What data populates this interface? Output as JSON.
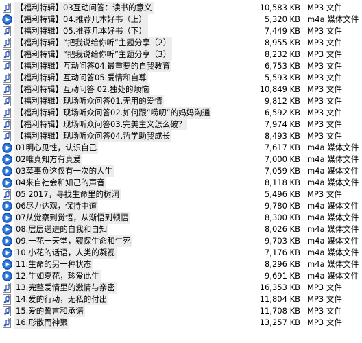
{
  "files": [
    {
      "name": "【福利特辑】03互动问答：读书的意义",
      "size": "10,583 KB",
      "type": "MP3 文件",
      "icon": "mp3-file-icon"
    },
    {
      "name": "【福利特辑】04.推荐几本好书（上）",
      "size": "5,320 KB",
      "type": "m4a 媒体文件",
      "icon": "m4a-media-icon"
    },
    {
      "name": "【福利特辑】05.推荐几本好书（下）",
      "size": "7,449 KB",
      "type": "MP3 文件",
      "icon": "mp3-file-icon"
    },
    {
      "name": "【福利特辑】“把我说给你听”主题分享（2）",
      "size": "8,955 KB",
      "type": "MP3 文件",
      "icon": "mp3-file-icon"
    },
    {
      "name": "【福利特辑】“把我说给你听”主题分享（3）",
      "size": "8,232 KB",
      "type": "MP3 文件",
      "icon": "mp3-file-icon"
    },
    {
      "name": "【福利特辑】互动问答04.最重要的自我教育",
      "size": "6,753 KB",
      "type": "MP3 文件",
      "icon": "mp3-file-icon"
    },
    {
      "name": "【福利特辑】互动问答05.爱情和自尊",
      "size": "5,593 KB",
      "type": "MP3 文件",
      "icon": "mp3-file-icon"
    },
    {
      "name": "【福利特辑】互动问答 02.独处的烦恼",
      "size": "10,849 KB",
      "type": "MP3 文件",
      "icon": "mp3-file-icon"
    },
    {
      "name": "【福利特辑】现场听众问答01.无用的爱情",
      "size": "9,812 KB",
      "type": "MP3 文件",
      "icon": "mp3-file-icon"
    },
    {
      "name": "【福利特辑】现场听众问答02.如何跟“唠叨”的妈妈沟通",
      "size": "6,592 KB",
      "type": "MP3 文件",
      "icon": "mp3-file-icon"
    },
    {
      "name": "【福利特辑】现场听众问答03.完美主义怎么破？",
      "size": "7,974 KB",
      "type": "MP3 文件",
      "icon": "mp3-file-icon"
    },
    {
      "name": "【福利特辑】现场听众问答04.哲学助我成长",
      "size": "8,493 KB",
      "type": "MP3 文件",
      "icon": "mp3-file-icon"
    },
    {
      "name": "01明心见性，认识自己",
      "size": "7,617 KB",
      "type": "m4a 媒体文件",
      "icon": "m4a-media-icon"
    },
    {
      "name": "02唯真知方有真爱",
      "size": "7,000 KB",
      "type": "m4a 媒体文件",
      "icon": "m4a-media-icon"
    },
    {
      "name": "03莫辜负这仅有一次的人生",
      "size": "7,059 KB",
      "type": "m4a 媒体文件",
      "icon": "m4a-media-icon"
    },
    {
      "name": "04来自社会和知己的声音",
      "size": "8,118 KB",
      "type": "m4a 媒体文件",
      "icon": "m4a-media-icon"
    },
    {
      "name": "05 2017，寻找生命里的树洞",
      "size": "5,496 KB",
      "type": "MP3 文件",
      "icon": "mp3-file-icon"
    },
    {
      "name": "06尽力达观，保持中道",
      "size": "9,780 KB",
      "type": "m4a 媒体文件",
      "icon": "m4a-media-icon"
    },
    {
      "name": "07从觉察到觉悟，从渐悟到顿悟",
      "size": "8,300 KB",
      "type": "m4a 媒体文件",
      "icon": "m4a-media-icon"
    },
    {
      "name": "08.层层递进的自我和自知",
      "size": "8,026 KB",
      "type": "m4a 媒体文件",
      "icon": "m4a-media-icon"
    },
    {
      "name": "09.一花一天堂，窥探生命和生死",
      "size": "9,703 KB",
      "type": "m4a 媒体文件",
      "icon": "m4a-media-icon"
    },
    {
      "name": "10.小花的话语，人类的凝视",
      "size": "7,176 KB",
      "type": "m4a 媒体文件",
      "icon": "m4a-media-icon"
    },
    {
      "name": "11.生命的另一种状态",
      "size": "8,296 KB",
      "type": "m4a 媒体文件",
      "icon": "m4a-media-icon"
    },
    {
      "name": "12.生如夏花，珍爱此生",
      "size": "9,691 KB",
      "type": "m4a 媒体文件",
      "icon": "m4a-media-icon"
    },
    {
      "name": "13.完整爱情里的激情与亲密",
      "size": "16,353 KB",
      "type": "MP3 文件",
      "icon": "mp3-file-icon"
    },
    {
      "name": "14.爱的行动，无私的付出",
      "size": "11,804 KB",
      "type": "MP3 文件",
      "icon": "mp3-file-icon"
    },
    {
      "name": "15.爱的誓言和承诺",
      "size": "11,708 KB",
      "type": "MP3 文件",
      "icon": "mp3-file-icon"
    },
    {
      "name": "16.形散而神聚",
      "size": "13,257 KB",
      "type": "MP3 文件",
      "icon": "mp3-file-icon"
    }
  ],
  "colors": {
    "row_highlight": "#ededed",
    "m4a_icon_blue": "#1c63c9",
    "mp3_icon_note": "#2a55b5"
  }
}
